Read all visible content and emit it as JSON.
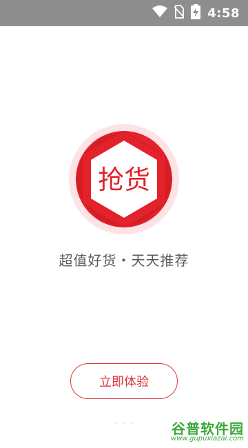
{
  "status_bar": {
    "time": "4:58",
    "icons": [
      "wifi-icon",
      "no-sim-icon",
      "battery-charging-icon"
    ],
    "background": "#8e8e8e"
  },
  "logo": {
    "text": "抢货",
    "primary_color": "#e3222b",
    "ring_color": "#fde3e4"
  },
  "tagline": "超值好货・天天推荐",
  "cta": {
    "label": "立即体验",
    "color": "#d9353a"
  },
  "watermark": {
    "title": "谷普软件园",
    "url": "www.gupuxiazai.com",
    "color": "#3aa83a"
  }
}
